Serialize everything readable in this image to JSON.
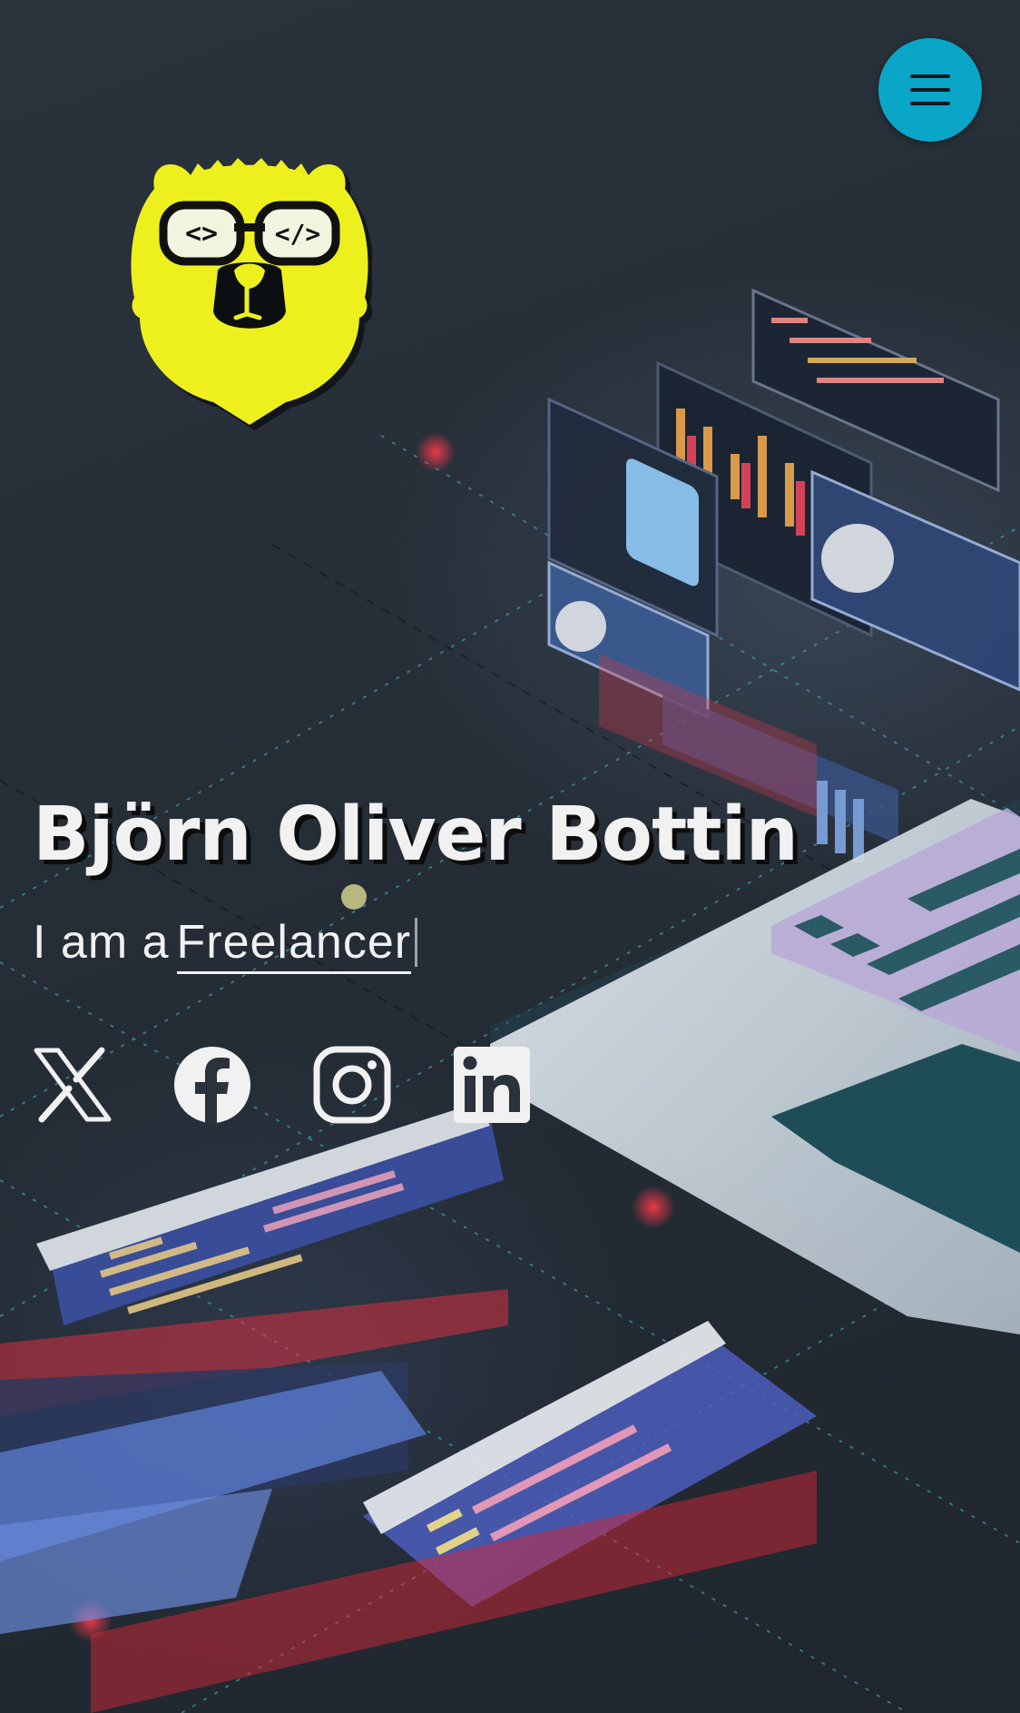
{
  "header": {
    "menu_icon": "hamburger-icon",
    "menu_button_color": "#0aa6c8"
  },
  "logo": {
    "icon": "bear-with-glasses-logo",
    "color": "#eef01e",
    "left_lens_text": "<>",
    "right_lens_text": "</>"
  },
  "hero": {
    "name": "Björn Oliver Bottin",
    "tagline_prefix": "I am a",
    "tagline_role": "Freelancer"
  },
  "social": [
    {
      "icon": "x-icon",
      "label": "X"
    },
    {
      "icon": "facebook-icon",
      "label": "Facebook"
    },
    {
      "icon": "instagram-icon",
      "label": "Instagram"
    },
    {
      "icon": "linkedin-icon",
      "label": "LinkedIn"
    }
  ],
  "colors": {
    "text": "#f1f1f1",
    "background": "#252d36"
  }
}
